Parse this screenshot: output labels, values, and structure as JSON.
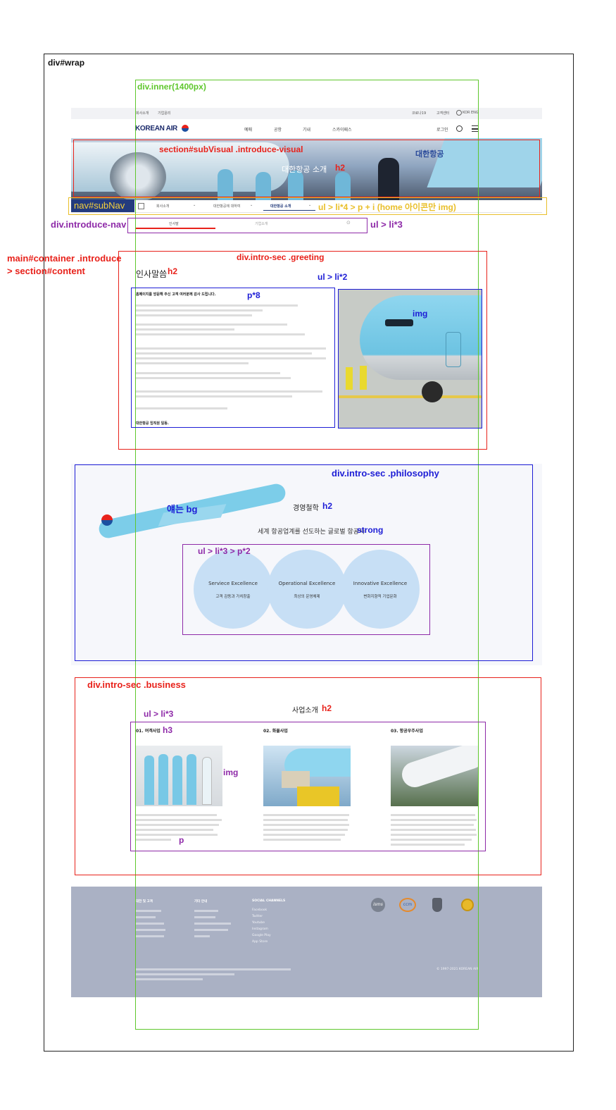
{
  "labels": {
    "wrap": "div#wrap",
    "inner": "div.inner(1400px)",
    "sub_visual": "section#subVisual .introduce-visual",
    "visual_h2": "h2",
    "sub_nav": "nav#subNav",
    "sub_nav_ul": "ul > li*4 > p + i (home 아이콘만 img)",
    "introduce_nav": "div.introduce-nav",
    "introduce_ul": "ul > li*3",
    "main_container": "main#container .introduce",
    "main_content": "> section#content",
    "greeting": "div.intro-sec .greeting",
    "greeting_h2": "h2",
    "greeting_ul": "ul > li*2",
    "greeting_p": "p*8",
    "greeting_img": "img",
    "philosophy": "div.intro-sec .philosophy",
    "philosophy_bg": "얘는 bg",
    "philosophy_h2": "h2",
    "philosophy_strong": "strong",
    "philosophy_ul": "ul > li*3 > p*2",
    "business": "div.intro-sec .business",
    "business_h2": "h2",
    "business_ul": "ul > li*3",
    "business_h3": "h3",
    "business_img": "img",
    "business_p": "p"
  },
  "mockup": {
    "top_links": [
      "회사소개",
      "기업윤리"
    ],
    "util_links": [
      "코로나19",
      "고객센터",
      "KOR ENG"
    ],
    "logo": "KOREAN AIR",
    "gnb": [
      "예매",
      "공항",
      "기내",
      "스카이패스"
    ],
    "login": "로그인",
    "visual_sign": "대한항공",
    "visual_title": "대한항공 소개",
    "subnav": [
      "회사소개",
      "대한항공에 대하여",
      "대한항공 소개"
    ],
    "intro_nav": [
      "인사말",
      "기업소개"
    ],
    "greeting_title": "인사말씀",
    "greeting_lead": "홈페이지를 방문해 주신 고객 여러분께 감사 드립니다.",
    "greeting_sign": "대한항공 임직원 일동.",
    "philosophy_title": "경영철학",
    "philosophy_strong": "세계 항공업계를 선도하는 글로벌 항공사",
    "philosophy_items": [
      {
        "title": "Serviece Excellence",
        "sub": "고객 감동과 가치창출"
      },
      {
        "title": "Operational Excellence",
        "sub": "최상의 운영체제"
      },
      {
        "title": "Innovative Excellence",
        "sub": "변화지향적 기업문화"
      }
    ],
    "business_title": "사업소개",
    "business_items": [
      "01. 여객사업",
      "02. 화물사업",
      "03. 항공우주사업"
    ],
    "footer_heads": [
      "대한 및 고객",
      "기타 안내",
      "SOCIAL CHANNELS"
    ],
    "footer_social": [
      "Facebook",
      "Twitter",
      "Youtube",
      "Instagram",
      "Google Play",
      "App Store"
    ],
    "footer_badges": [
      "isms",
      "ccm"
    ],
    "footer_copy": "© 1997-2021 KOREAN AIR"
  },
  "colors": {
    "red": "#e8221b",
    "blue": "#1d1dd6",
    "green": "#5ec72c",
    "purple": "#8e2aa8",
    "yellow": "#e9bf2a",
    "navy_fill": "#233b7e",
    "circle": "#c7dff5",
    "footer": "#aab1c4",
    "sky": "#78c8e6"
  }
}
